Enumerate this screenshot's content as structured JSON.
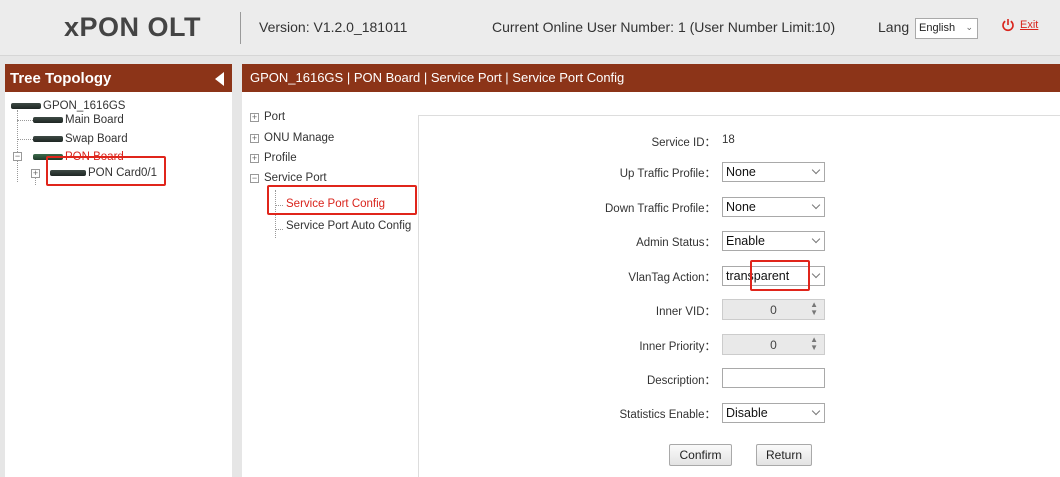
{
  "header": {
    "logo": "xPON OLT",
    "version": "Version: V1.2.0_181011",
    "online_users": "Current Online User Number: 1 (User Number Limit:10)",
    "lang_label": "Lang",
    "lang_value": "English",
    "exit_label": "Exit"
  },
  "sidebar": {
    "title": "Tree Topology",
    "nodes": [
      {
        "label": "GPON_1616GS"
      },
      {
        "label": "Main Board"
      },
      {
        "label": "Swap Board"
      },
      {
        "label": "PON Board"
      },
      {
        "label": "PON Card0/1"
      }
    ]
  },
  "main": {
    "breadcrumb": "GPON_1616GS | PON Board | Service Port | Service Port Config",
    "menu": {
      "port": "Port",
      "onu_manage": "ONU Manage",
      "profile": "Profile",
      "service_port": "Service Port",
      "service_port_config": "Service Port Config",
      "service_port_auto_config": "Service Port Auto Config"
    },
    "form": {
      "service_id_label": "Service ID：",
      "service_id_value": "18",
      "up_traffic_label": "Up Traffic Profile：",
      "up_traffic_value": "None",
      "down_traffic_label": "Down Traffic Profile：",
      "down_traffic_value": "None",
      "admin_status_label": "Admin Status：",
      "admin_status_value": "Enable",
      "vlantag_label": "VlanTag Action：",
      "vlantag_value": "transparent",
      "inner_vid_label": "Inner VID：",
      "inner_vid_value": "0",
      "inner_priority_label": "Inner Priority：",
      "inner_priority_value": "0",
      "description_label": "Description：",
      "description_value": "",
      "statistics_label": "Statistics Enable：",
      "statistics_value": "Disable",
      "confirm_label": "Confirm",
      "return_label": "Return"
    }
  },
  "colors": {
    "title_bar": "#8c3418",
    "accent_red": "#d9241c",
    "highlight_box": "#e0251b"
  }
}
